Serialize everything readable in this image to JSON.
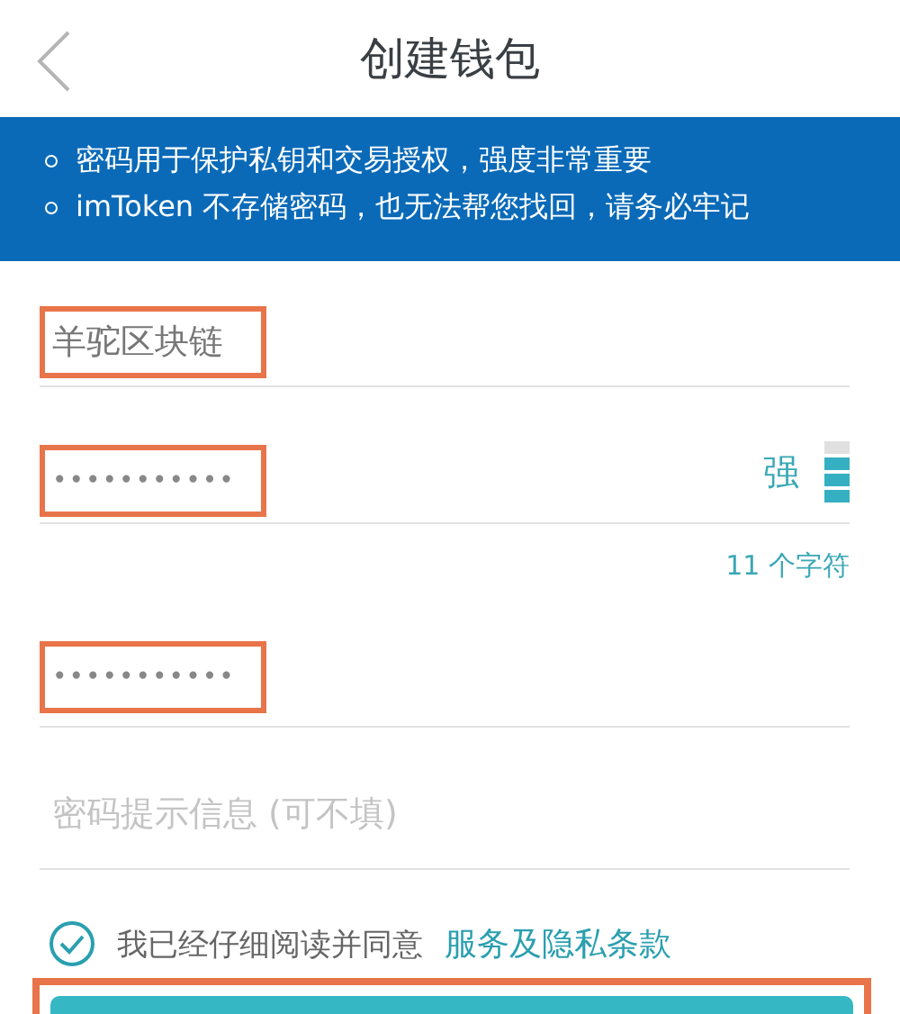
{
  "header": {
    "title": "创建钱包"
  },
  "notice": [
    "密码用于保护私钥和交易授权，强度非常重要",
    "imToken 不存储密码，也无法帮您找回，请务必牢记"
  ],
  "fields": [
    {
      "kind": "text",
      "value": "羊驼区块链",
      "highlighted": true
    },
    {
      "kind": "password",
      "value": "•••••••••••",
      "highlighted": true,
      "strength": {
        "label": "强",
        "level": 0.75
      },
      "counter": "11 个字符"
    },
    {
      "kind": "password",
      "value": "•••••••••••",
      "highlighted": true
    },
    {
      "kind": "text",
      "placeholder": "密码提示信息 (可不填)",
      "highlighted": false
    }
  ],
  "agreement": {
    "checked": true,
    "text": "我已经仔细阅读并同意",
    "link": "服务及隐私条款"
  },
  "submit": {
    "highlighted": true
  }
}
